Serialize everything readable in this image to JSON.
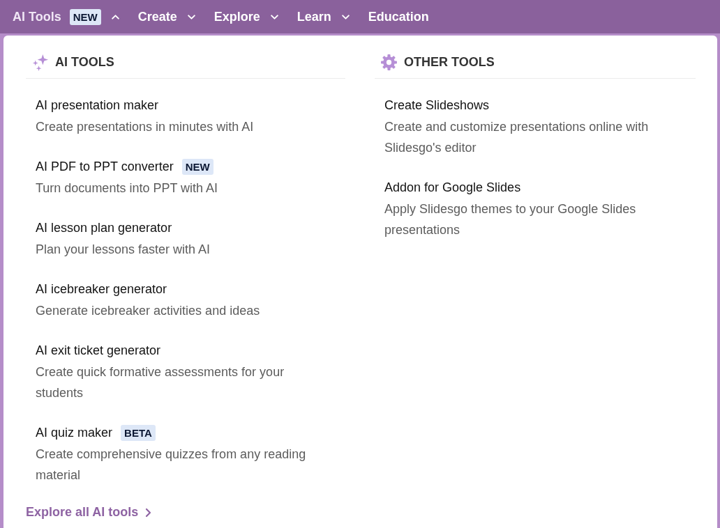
{
  "nav": [
    {
      "label": "AI Tools",
      "badge": "NEW",
      "kind": "dropdown",
      "expanded": true
    },
    {
      "label": "Create",
      "kind": "dropdown",
      "expanded": false
    },
    {
      "label": "Explore",
      "kind": "dropdown",
      "expanded": false
    },
    {
      "label": "Learn",
      "kind": "dropdown",
      "expanded": false
    },
    {
      "label": "Education",
      "kind": "link"
    }
  ],
  "sections": [
    {
      "title": "AI TOOLS",
      "kind": "ai",
      "items": [
        {
          "title": "AI presentation maker",
          "description": "Create presentations in minutes with AI"
        },
        {
          "title": "AI PDF to PPT converter",
          "badge": "NEW",
          "description": "Turn documents into PPT with AI"
        },
        {
          "title": "AI lesson plan generator",
          "description": "Plan your lessons faster with AI"
        },
        {
          "title": "AI icebreaker generator",
          "description": "Generate icebreaker activities and ideas"
        },
        {
          "title": "AI exit ticket generator",
          "description": "Create quick formative assessments for your students"
        },
        {
          "title": "AI quiz maker",
          "badge": "BETA",
          "description": "Create comprehensive quizzes from any reading material"
        }
      ],
      "footer_link": "Explore all AI tools"
    },
    {
      "title": "OTHER TOOLS",
      "kind": "other",
      "items": [
        {
          "title": "Create Slideshows",
          "description": "Create and customize presentations online with Slidesgo's editor"
        },
        {
          "title": "Addon for Google Slides",
          "description": "Apply Slidesgo themes to your Google Slides presentations"
        }
      ]
    }
  ]
}
